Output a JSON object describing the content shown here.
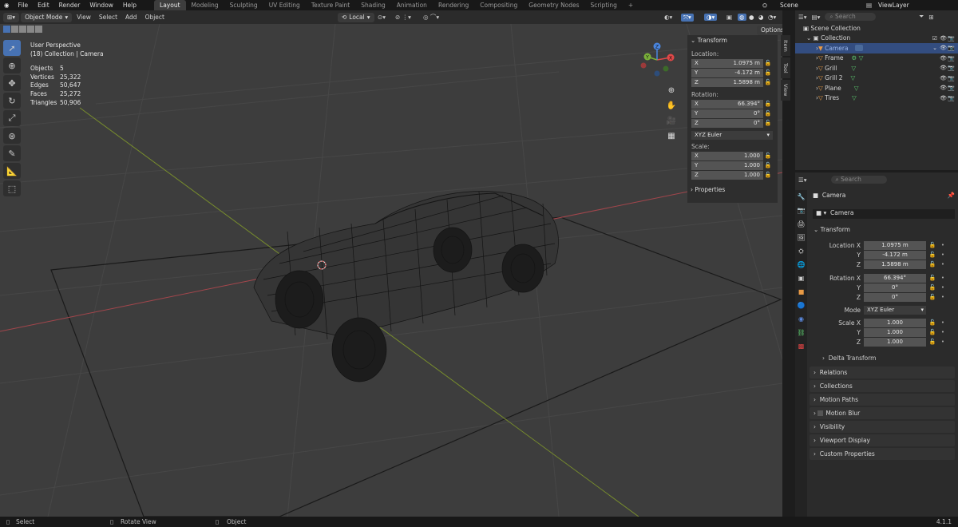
{
  "menu": [
    "File",
    "Edit",
    "Render",
    "Window",
    "Help"
  ],
  "workspaces": [
    "Layout",
    "Modeling",
    "Sculpting",
    "UV Editing",
    "Texture Paint",
    "Shading",
    "Animation",
    "Rendering",
    "Compositing",
    "Geometry Nodes",
    "Scripting"
  ],
  "scene": "Scene",
  "viewlayer": "ViewLayer",
  "viewport_header": {
    "mode": "Object Mode",
    "menus": [
      "View",
      "Select",
      "Add",
      "Object"
    ],
    "transform_orientation": "Local",
    "options": "Options"
  },
  "overlay_text": {
    "perspective": "User Perspective",
    "collection": "(18) Collection | Camera"
  },
  "stats": [
    {
      "k": "Objects",
      "v": "5"
    },
    {
      "k": "Vertices",
      "v": "25,322"
    },
    {
      "k": "Edges",
      "v": "50,647"
    },
    {
      "k": "Faces",
      "v": "25,272"
    },
    {
      "k": "Triangles",
      "v": "50,906"
    }
  ],
  "gizmo": {
    "x": "X",
    "y": "Y",
    "z": "Z"
  },
  "npanel": {
    "title": "Transform",
    "location_label": "Location:",
    "loc": [
      "1.0975 m",
      "-4.172 m",
      "1.5898 m"
    ],
    "rotation_label": "Rotation:",
    "rot": [
      "66.394°",
      "0°",
      "0°"
    ],
    "rot_mode": "XYZ Euler",
    "scale_label": "Scale:",
    "scale": [
      "1.000",
      "1.000",
      "1.000"
    ],
    "properties": "Properties",
    "axes": [
      "X",
      "Y",
      "Z"
    ]
  },
  "vtabs": [
    "Item",
    "Tool",
    "View"
  ],
  "outliner": {
    "search": "Search",
    "scene_collection": "Scene Collection",
    "collection": "Collection",
    "items": [
      "Camera",
      "Frame",
      "Grill",
      "Grill 2",
      "Plane",
      "Tires"
    ]
  },
  "props": {
    "search": "Search",
    "object": "Camera",
    "data": "Camera",
    "transform": "Transform",
    "location_x_label": "Location X",
    "rotation_x_label": "Rotation X",
    "mode_label": "Mode",
    "scale_x_label": "Scale X",
    "y": "Y",
    "z": "Z",
    "loc": [
      "1.0975 m",
      "-4.172 m",
      "1.5898 m"
    ],
    "rot": [
      "66.394°",
      "0°",
      "0°"
    ],
    "mode": "XYZ Euler",
    "scale": [
      "1.000",
      "1.000",
      "1.000"
    ],
    "delta": "Delta Transform",
    "sections": [
      "Relations",
      "Collections",
      "Motion Paths",
      "Motion Blur",
      "Visibility",
      "Viewport Display",
      "Custom Properties"
    ]
  },
  "status": {
    "select": "Select",
    "rotate": "Rotate View",
    "object": "Object",
    "version": "4.1.1"
  }
}
